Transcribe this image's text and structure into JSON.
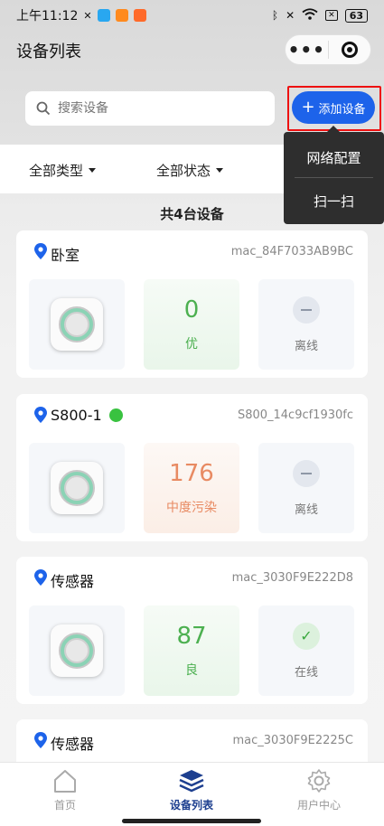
{
  "status_bar": {
    "time": "上午11:12",
    "battery": "63"
  },
  "header": {
    "title": "设备列表"
  },
  "search": {
    "placeholder": "搜索设备"
  },
  "add_button": {
    "label": "添加设备"
  },
  "dropdown_menu": {
    "items": [
      "网络配置",
      "扫一扫"
    ]
  },
  "filters": {
    "type": "全部类型",
    "status": "全部状态"
  },
  "device_count": "共4台设备",
  "devices": [
    {
      "name": "卧室",
      "mac": "mac_84F7033AB9BC",
      "online_dot": false,
      "aqi": "0",
      "aqi_level": "优",
      "aqi_color": "#4cb050",
      "status": "离线"
    },
    {
      "name": "S800-1",
      "mac": "S800_14c9cf1930fc",
      "online_dot": true,
      "aqi": "176",
      "aqi_level": "中度污染",
      "aqi_color": "#e88a62",
      "status": "离线"
    },
    {
      "name": "传感器",
      "mac": "mac_3030F9E222D8",
      "online_dot": false,
      "aqi": "87",
      "aqi_level": "良",
      "aqi_color": "#4cb050",
      "status": "在线"
    },
    {
      "name": "传感器",
      "mac": "mac_3030F9E2225C"
    }
  ],
  "tab_bar": {
    "home": "首页",
    "devices": "设备列表",
    "user": "用户中心"
  },
  "colors": {
    "accent": "#1d63ea",
    "active_tab": "#1d3f8f",
    "online": "#39c240"
  }
}
